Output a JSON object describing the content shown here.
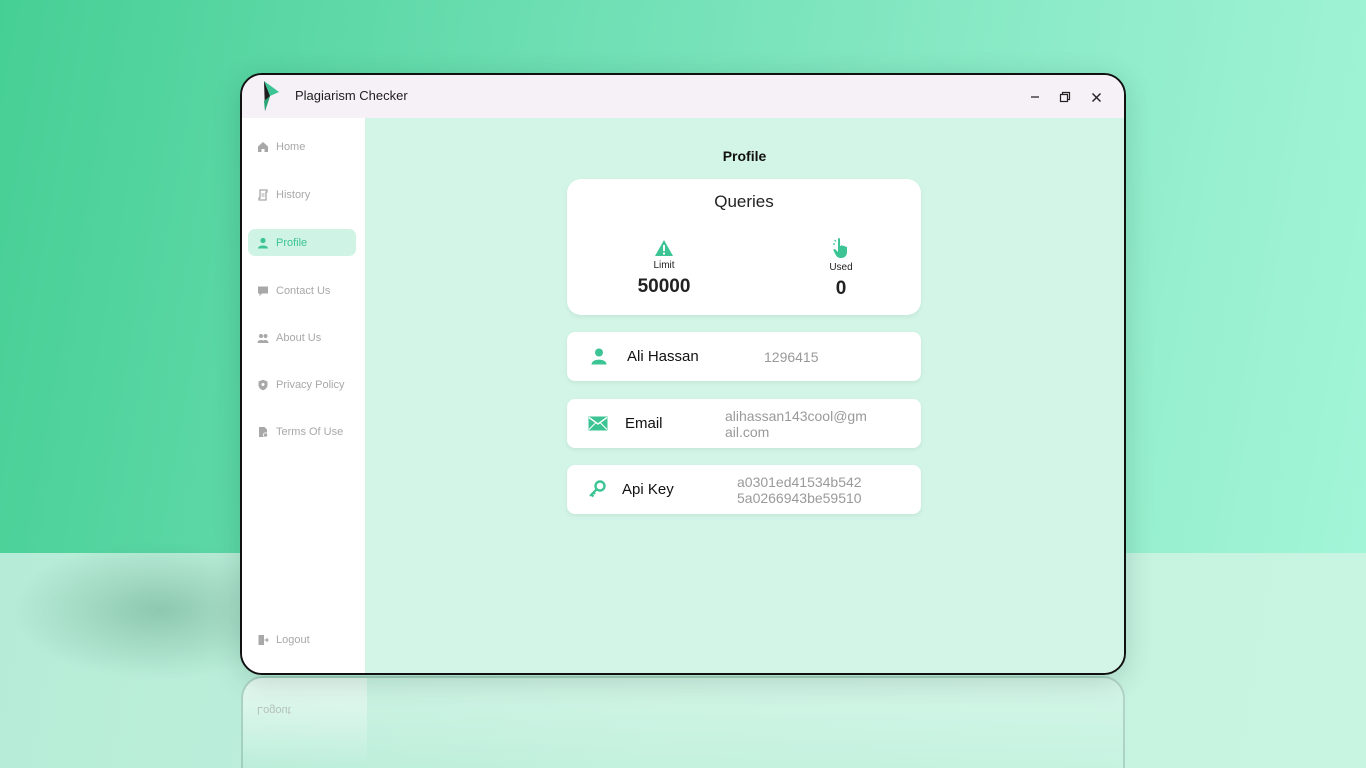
{
  "app": {
    "title": "Plagiarism Checker"
  },
  "window_controls": {
    "minimize": "–",
    "restore": "❐",
    "close": "✕"
  },
  "sidebar": {
    "items": [
      {
        "label": "Home",
        "icon": "home-icon"
      },
      {
        "label": "History",
        "icon": "history-icon"
      },
      {
        "label": "Profile",
        "icon": "user-icon",
        "active": true
      },
      {
        "label": "Contact Us",
        "icon": "chat-icon"
      },
      {
        "label": "About Us",
        "icon": "group-icon"
      },
      {
        "label": "Privacy Policy",
        "icon": "shield-icon"
      },
      {
        "label": "Terms Of Use",
        "icon": "document-icon"
      }
    ],
    "logout": {
      "label": "Logout",
      "icon": "logout-icon"
    }
  },
  "profile": {
    "page_title": "Profile",
    "queries": {
      "title": "Queries",
      "limit_label": "Limit",
      "limit_value": "50000",
      "used_label": "Used",
      "used_value": "0"
    },
    "name_card": {
      "label": "Ali Hassan",
      "value": "1296415"
    },
    "email_card": {
      "label": "Email",
      "value_line1": "alihassan143cool@gm",
      "value_line2": "ail.com"
    },
    "api_card": {
      "label": "Api Key",
      "value_line1": "a0301ed41534b542",
      "value_line2": "5a0266943be59510"
    }
  },
  "reflection": {
    "text": "Logout"
  },
  "colors": {
    "accent": "#3cc494",
    "main_bg": "#d3f5e7",
    "sidebar_active_bg": "#cff3e4",
    "titlebar_bg": "#f6f1f7"
  }
}
